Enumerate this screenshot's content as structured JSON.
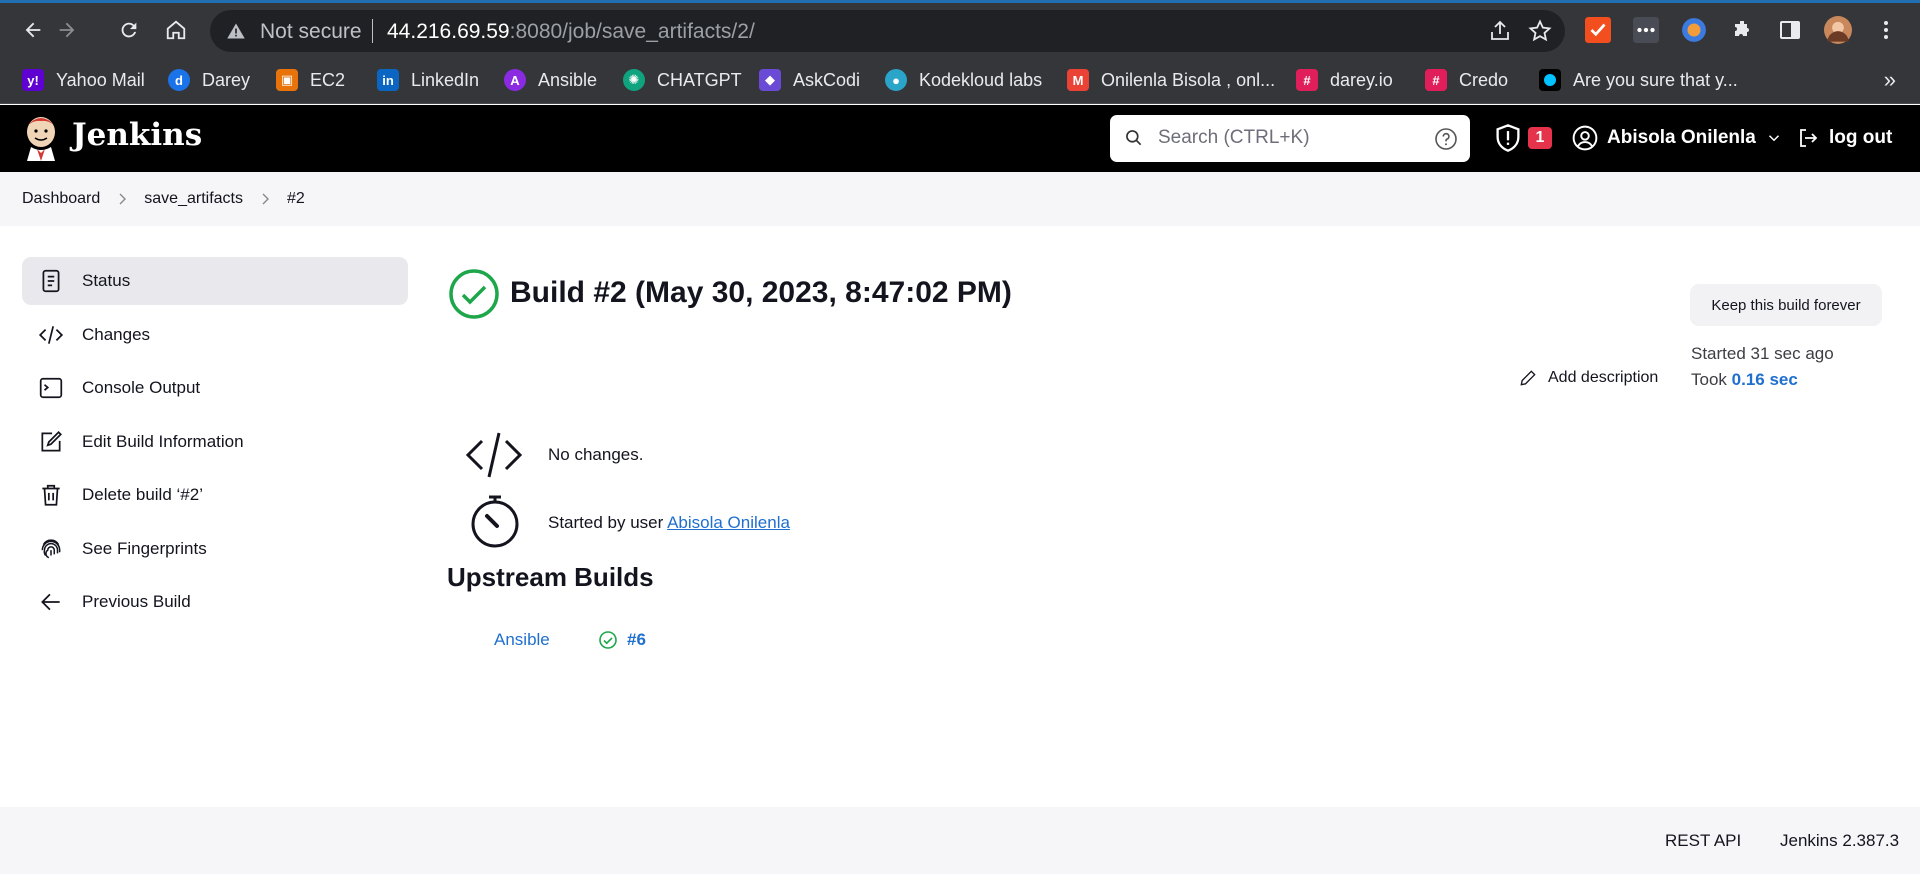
{
  "browser": {
    "not_secure": "Not secure",
    "url_host": "44.216.69.59",
    "url_rest": ":8080/job/save_artifacts/2/",
    "bookmarks": [
      {
        "label": "Yahoo Mail",
        "icon": "yahoo-icon",
        "color": "#5f01d1"
      },
      {
        "label": "Darey",
        "icon": "darey-icon",
        "color": "#1a73e8"
      },
      {
        "label": "EC2",
        "icon": "aws-ec2-icon",
        "color": "#e8730b"
      },
      {
        "label": "LinkedIn",
        "icon": "linkedin-icon",
        "color": "#0a66c2"
      },
      {
        "label": "Ansible",
        "icon": "ansible-icon",
        "color": "#8a2be2"
      },
      {
        "label": "CHATGPT",
        "icon": "chatgpt-icon",
        "color": "#10a37f"
      },
      {
        "label": "AskCodi",
        "icon": "askcodi-icon",
        "color": "#6a4bd6"
      },
      {
        "label": "Kodekloud labs",
        "icon": "kodekloud-icon",
        "color": "#2aa5c9"
      },
      {
        "label": "Onilenla Bisola , onl...",
        "icon": "gmail-icon",
        "color": "#ea4335"
      },
      {
        "label": "darey.io",
        "icon": "slack-icon",
        "color": "#e01e5a"
      },
      {
        "label": "Credo",
        "icon": "slack-icon",
        "color": "#e01e5a"
      },
      {
        "label": "Are you sure that y...",
        "icon": "tab-icon",
        "color": "#00c2ff"
      }
    ]
  },
  "header": {
    "brand": "Jenkins",
    "search_placeholder": "Search (CTRL+K)",
    "security_count": "1",
    "user": "Abisola Onilenla",
    "logout": "log out"
  },
  "breadcrumb": [
    "Dashboard",
    "save_artifacts",
    "#2"
  ],
  "sidebar": {
    "items": [
      {
        "label": "Status",
        "icon": "document-icon"
      },
      {
        "label": "Changes",
        "icon": "code-icon"
      },
      {
        "label": "Console Output",
        "icon": "terminal-icon"
      },
      {
        "label": "Edit Build Information",
        "icon": "edit-icon"
      },
      {
        "label": "Delete build ‘#2’",
        "icon": "trash-icon"
      },
      {
        "label": "See Fingerprints",
        "icon": "fingerprint-icon"
      },
      {
        "label": "Previous Build",
        "icon": "arrow-left-icon"
      }
    ]
  },
  "build": {
    "title": "Build #2 (May 30, 2023, 8:47:02 PM)",
    "keep_forever": "Keep this build forever",
    "started": "Started 31 sec ago",
    "took_label": "Took ",
    "took_value": "0.16 sec",
    "add_description": "Add description",
    "no_changes": "No changes.",
    "started_by_prefix": "Started by user ",
    "started_by_user": "Abisola Onilenla"
  },
  "upstream": {
    "heading": "Upstream Builds",
    "job": "Ansible",
    "build": "#6"
  },
  "footer": {
    "rest_api": "REST API",
    "version": "Jenkins 2.387.3"
  },
  "colors": {
    "success": "#1ea64b",
    "link": "#1f6fcf",
    "badge": "#e6334c"
  }
}
